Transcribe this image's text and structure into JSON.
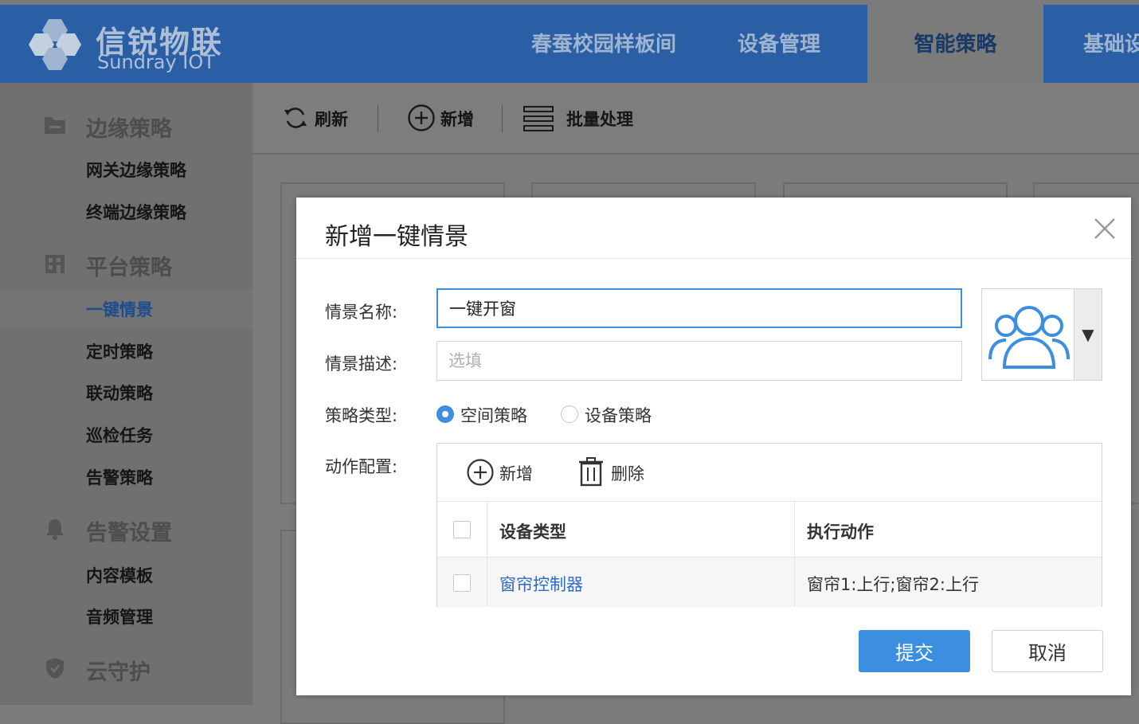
{
  "brand": {
    "name_cn": "信锐物联",
    "name_en": "Sundray IOT"
  },
  "nav": {
    "items": [
      {
        "label": "春蚕校园样板间"
      },
      {
        "label": "设备管理"
      },
      {
        "label": "智能策略",
        "active": true
      },
      {
        "label": "基础设"
      }
    ]
  },
  "sidebar": {
    "groups": [
      {
        "label": "边缘策略",
        "icon": "folder-icon",
        "items": [
          "网关边缘策略",
          "终端边缘策略"
        ]
      },
      {
        "label": "平台策略",
        "icon": "building-icon",
        "items": [
          "一键情景",
          "定时策略",
          "联动策略",
          "巡检任务",
          "告警策略"
        ]
      },
      {
        "label": "告警设置",
        "icon": "bell-icon",
        "items": [
          "内容模板",
          "音频管理"
        ]
      },
      {
        "label": "云守护",
        "icon": "shield-icon",
        "items": []
      }
    ],
    "active_item": "一键情景"
  },
  "toolbar": {
    "refresh": "刷新",
    "add": "新增",
    "batch": "批量处理"
  },
  "modal": {
    "title": "新增一键情景",
    "fields": {
      "name_label": "情景名称:",
      "name_value": "一键开窗",
      "desc_label": "情景描述:",
      "desc_placeholder": "选填",
      "type_label": "策略类型:",
      "type_options": [
        "空间策略",
        "设备策略"
      ],
      "type_selected": "空间策略",
      "action_label": "动作配置:"
    },
    "icon_picker": {
      "icon": "users-icon"
    },
    "action": {
      "add": "新增",
      "delete": "删除",
      "columns": [
        "设备类型",
        "执行动作"
      ],
      "rows": [
        {
          "device_type": "窗帘控制器",
          "action": "窗帘1:上行;窗帘2:上行"
        }
      ]
    },
    "submit": "提交",
    "cancel": "取消"
  },
  "colors": {
    "primary": "#3c8fe0",
    "header": "#2a5ea5",
    "link": "#2e6bc4"
  }
}
